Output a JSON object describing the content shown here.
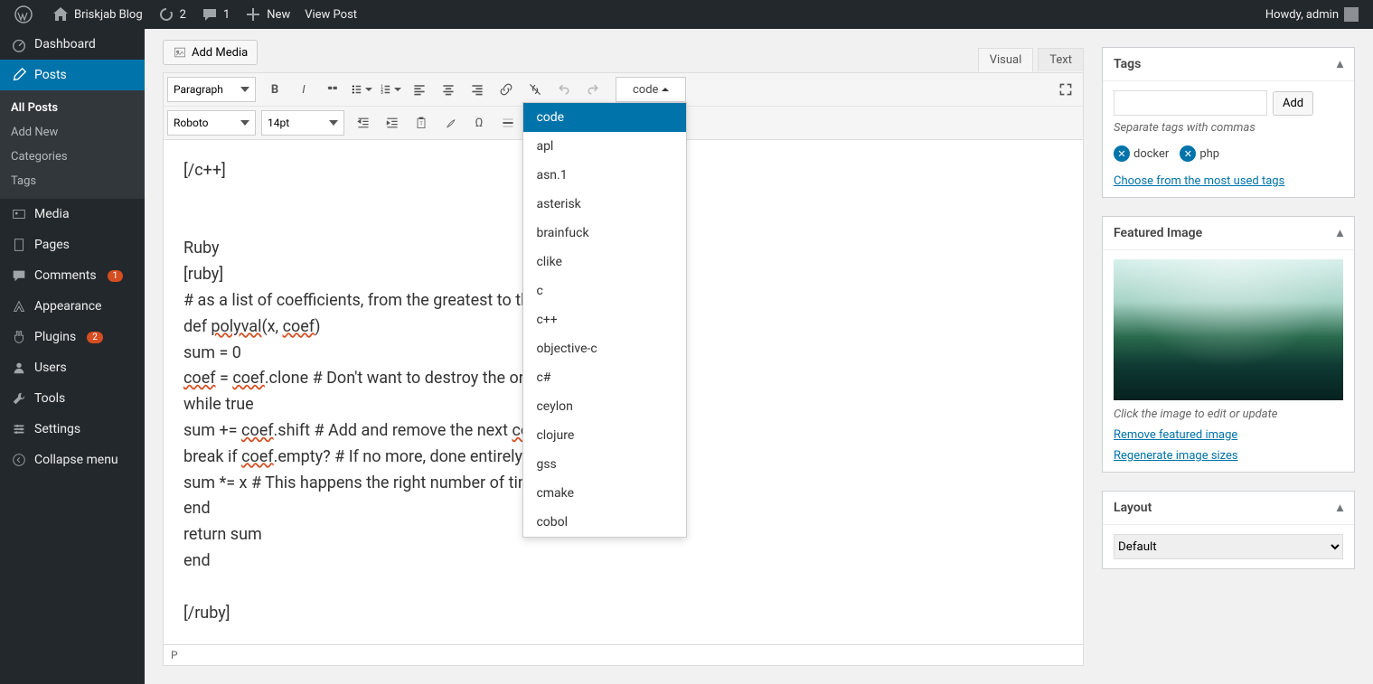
{
  "adminbar": {
    "site_name": "Briskjab Blog",
    "updates": "2",
    "comments": "1",
    "new_label": "New",
    "view_post": "View Post",
    "howdy": "Howdy, admin"
  },
  "sidebar": {
    "dashboard": "Dashboard",
    "posts": "Posts",
    "posts_sub": {
      "all": "All Posts",
      "add": "Add New",
      "cat": "Categories",
      "tags": "Tags"
    },
    "media": "Media",
    "pages": "Pages",
    "comments": "Comments",
    "comments_count": "1",
    "appearance": "Appearance",
    "plugins": "Plugins",
    "plugins_count": "2",
    "users": "Users",
    "tools": "Tools",
    "settings": "Settings",
    "collapse": "Collapse menu"
  },
  "editor": {
    "add_media": "Add Media",
    "tab_visual": "Visual",
    "tab_text": "Text",
    "format_select": "Paragraph",
    "font_select": "Roboto",
    "size_select": "14pt",
    "code_label": "code",
    "code_options": [
      "code",
      "apl",
      "asn.1",
      "asterisk",
      "brainfuck",
      "clike",
      "c",
      "c++",
      "objective-c",
      "c#",
      "ceylon",
      "clojure",
      "gss",
      "cmake",
      "cobol"
    ],
    "lines": [
      "[/c++]",
      "",
      "",
      "Ruby",
      "[ruby]",
      "# as a list of coefficients, from the greatest to the least.",
      "def polyval(x, coef)",
      "sum = 0",
      "coef = coef.clone # Don't want to destroy the original",
      "while true",
      "sum += coef.shift # Add and remove the next coef",
      "break if coef.empty? # If no more, done entirely.",
      "sum *= x # This happens the right number of times.",
      "end",
      "return sum",
      "end",
      "",
      "[/ruby]"
    ],
    "path": "P"
  },
  "tags_box": {
    "title": "Tags",
    "add_btn": "Add",
    "hint": "Separate tags with commas",
    "tags": [
      "docker",
      "php"
    ],
    "choose": "Choose from the most used tags"
  },
  "featured": {
    "title": "Featured Image",
    "hint": "Click the image to edit or update",
    "remove": "Remove featured image",
    "regen": "Regenerate image sizes"
  },
  "layout": {
    "title": "Layout",
    "value": "Default"
  }
}
